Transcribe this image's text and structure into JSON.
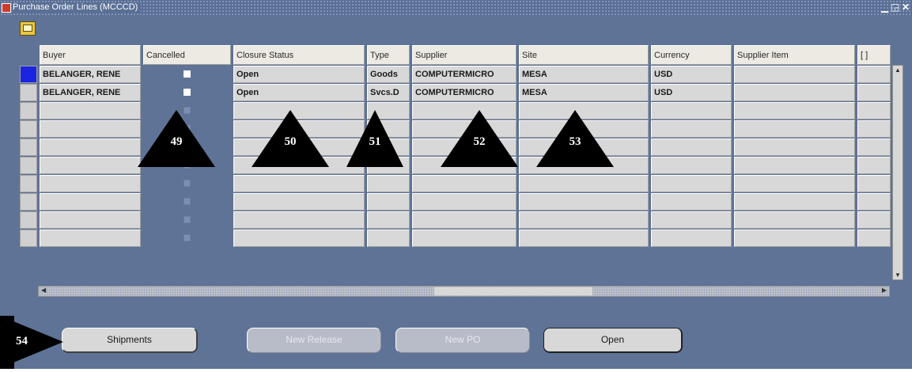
{
  "window": {
    "title": "Purchase Order Lines (MCCCD)",
    "controls": {
      "minimize": "▁",
      "maximize": "◲",
      "close": "✕"
    }
  },
  "toolbar_icon": "folder-edit-icon",
  "columns": [
    "Buyer",
    "Cancelled",
    "Closure Status",
    "Type",
    "Supplier",
    "Site",
    "Currency",
    "Supplier Item",
    "[ ]"
  ],
  "rows": [
    {
      "buyer": "BELANGER, RENE",
      "cancelled": true,
      "closure_status": "Open",
      "type": "Goods",
      "supplier": "COMPUTERMICRO",
      "site": "MESA",
      "currency": "USD",
      "supplier_item": "",
      "extra": "",
      "active": true
    },
    {
      "buyer": "BELANGER, RENE",
      "cancelled": true,
      "closure_status": "Open",
      "type": "Svcs.D",
      "supplier": "COMPUTERMICRO",
      "site": "MESA",
      "currency": "USD",
      "supplier_item": "",
      "extra": "",
      "active": false
    },
    {
      "buyer": "",
      "cancelled": false,
      "closure_status": "",
      "type": "",
      "supplier": "",
      "site": "",
      "currency": "",
      "supplier_item": "",
      "extra": "",
      "active": false
    },
    {
      "buyer": "",
      "cancelled": false,
      "closure_status": "",
      "type": "",
      "supplier": "",
      "site": "",
      "currency": "",
      "supplier_item": "",
      "extra": "",
      "active": false
    },
    {
      "buyer": "",
      "cancelled": false,
      "closure_status": "",
      "type": "",
      "supplier": "",
      "site": "",
      "currency": "",
      "supplier_item": "",
      "extra": "",
      "active": false
    },
    {
      "buyer": "",
      "cancelled": false,
      "closure_status": "",
      "type": "",
      "supplier": "",
      "site": "",
      "currency": "",
      "supplier_item": "",
      "extra": "",
      "active": false
    },
    {
      "buyer": "",
      "cancelled": false,
      "closure_status": "",
      "type": "",
      "supplier": "",
      "site": "",
      "currency": "",
      "supplier_item": "",
      "extra": "",
      "active": false
    },
    {
      "buyer": "",
      "cancelled": false,
      "closure_status": "",
      "type": "",
      "supplier": "",
      "site": "",
      "currency": "",
      "supplier_item": "",
      "extra": "",
      "active": false
    },
    {
      "buyer": "",
      "cancelled": false,
      "closure_status": "",
      "type": "",
      "supplier": "",
      "site": "",
      "currency": "",
      "supplier_item": "",
      "extra": "",
      "active": false
    },
    {
      "buyer": "",
      "cancelled": false,
      "closure_status": "",
      "type": "",
      "supplier": "",
      "site": "",
      "currency": "",
      "supplier_item": "",
      "extra": "",
      "active": false
    }
  ],
  "buttons": {
    "shipments": "Shipments",
    "new_release": "New Release",
    "new_po": "New PO",
    "open": "Open"
  },
  "callouts": [
    "49",
    "50",
    "51",
    "52",
    "53",
    "54"
  ]
}
